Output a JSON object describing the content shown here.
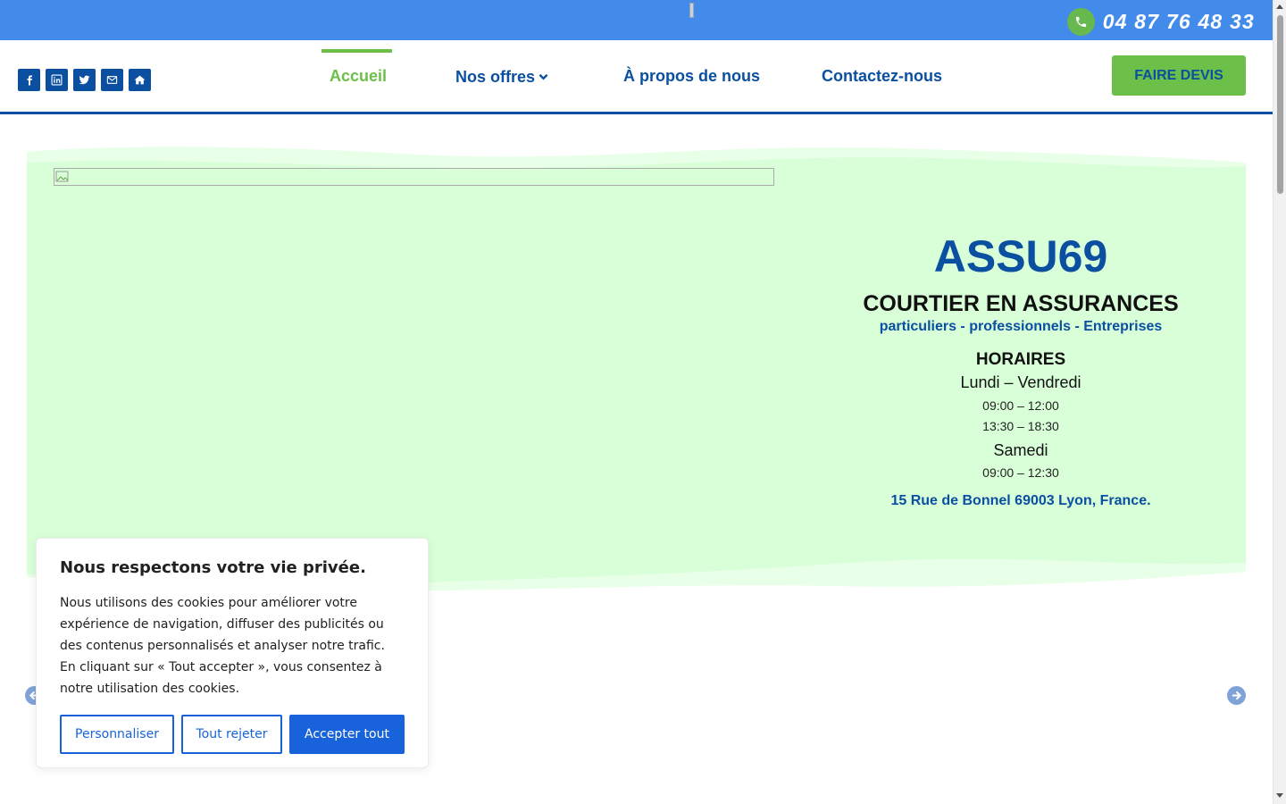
{
  "topbar": {
    "phone": "04 87 76 48 33",
    "phone_icon": "phone-icon",
    "background": "#428bea"
  },
  "header": {
    "socials": [
      "facebook-icon",
      "linkedin-icon",
      "twitter-icon",
      "email-icon",
      "home-icon"
    ],
    "nav": [
      {
        "label": "Accueil",
        "active": true
      },
      {
        "label": "Nos offres",
        "has_dropdown": true
      },
      {
        "label": "À propos de nous"
      },
      {
        "label": "Contactez-nous"
      }
    ],
    "cta_label": "FAIRE DEVIS"
  },
  "hero": {
    "brand": "ASSU69",
    "tagline": "COURTIER EN ASSURANCES",
    "audience": "particuliers - professionnels - Entreprises",
    "hours_title": "HORAIRES",
    "weekdays_label": "Lundi – Vendredi",
    "weekday_morning": "09:00 – 12:00",
    "weekday_afternoon": "13:30 – 18:30",
    "saturday_label": "Samedi",
    "saturday_hours": "09:00 – 12:30",
    "address": "15 Rue de Bonnel 69003 Lyon, France."
  },
  "slider": {
    "prev_icon": "arrow-left-circle-icon",
    "next_icon": "arrow-right-circle-icon"
  },
  "cookie": {
    "title": "Nous respectons votre vie privée.",
    "text": "Nous utilisons des cookies pour améliorer votre expérience de navigation, diffuser des publicités ou des contenus personnalisés et analyser notre trafic. En cliquant sur « Tout accepter », vous consentez à notre utilisation des cookies.",
    "customize_label": "Personnaliser",
    "reject_label": "Tout rejeter",
    "accept_label": "Accepter tout"
  },
  "colors": {
    "brand_blue": "#0a4fa0",
    "accent_green": "#6cc04a",
    "hero_green": "#d9ffd9",
    "cookie_blue": "#1863dc"
  }
}
